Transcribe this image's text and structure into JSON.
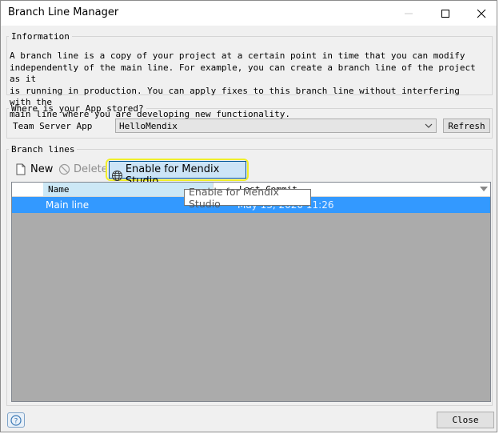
{
  "window": {
    "title": "Branch Line Manager"
  },
  "information": {
    "legend": "Information",
    "text": "A branch line is a copy of your project at a certain point in time that you can modify\nindependently of the main line. For example, you can create a branch line of the project as it\nis running in production. You can apply fixes to this branch line without interfering with the\nmain line where you are developing new functionality."
  },
  "storage": {
    "legend": "Where is your App stored?",
    "team_server_label": "Team Server App",
    "selected_app": "HelloMendix",
    "refresh_label": "Refresh"
  },
  "branch_lines": {
    "legend": "Branch lines",
    "toolbar": {
      "new_label": "New",
      "delete_label": "Delete",
      "enable_label": "Enable for Mendix Studio"
    },
    "columns": [
      "Name",
      "Last Commit"
    ],
    "rows": [
      {
        "name": "Main line",
        "last_commit": "May 13, 2020 11:26"
      }
    ]
  },
  "tooltip": "Enable for Mendix Studio",
  "footer": {
    "close_label": "Close"
  },
  "colors": {
    "selection": "#3399ff",
    "highlight": "#f0ef2a",
    "grid_background": "#ababab"
  }
}
